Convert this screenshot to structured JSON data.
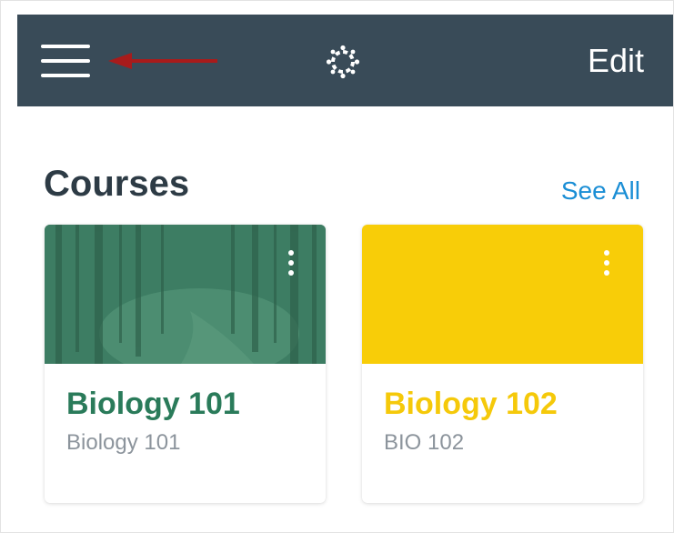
{
  "header": {
    "menu_icon": "hamburger-menu-icon",
    "logo_icon": "canvas-logo-icon",
    "annotation_icon": "red-arrow-icon",
    "edit_label": "Edit",
    "background_color": "#394b58",
    "arrow_color": "#a81b1b"
  },
  "courses": {
    "title": "Courses",
    "see_all_label": "See All",
    "link_color": "#1a8ed5",
    "cards": [
      {
        "name": "Biology 101",
        "code": "Biology 101",
        "color": "#2a7b5a",
        "image_icon": "forest-image-icon"
      },
      {
        "name": "Biology 102",
        "code": "BIO 102",
        "color": "#f5c90a"
      }
    ]
  }
}
